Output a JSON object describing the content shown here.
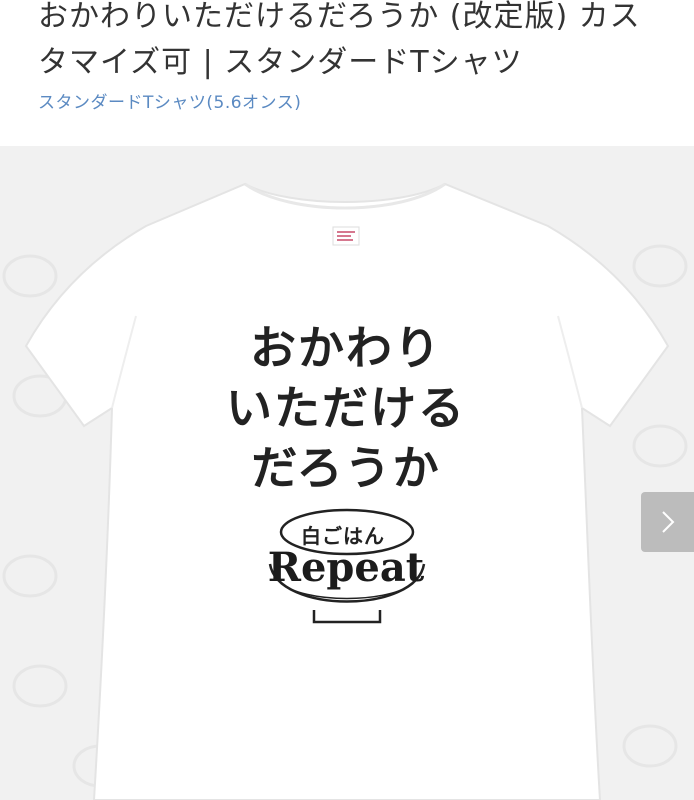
{
  "product": {
    "title": "おかわりいただけるだろうか (改定版) カスタマイズ可 | スタンダードTシャツ",
    "category_link": "スタンダードTシャツ(5.6オンス)"
  },
  "print": {
    "line1": "おかわり",
    "line2": "いただける",
    "line3": "だろうか",
    "bowl_label": "白ごはん",
    "repeat": "Repeat"
  },
  "colors": {
    "title": "#333333",
    "link": "#5b8ac2",
    "background": "#f1f1f1",
    "shirt": "#ffffff"
  },
  "icons": {
    "next": "chevron-right-icon"
  }
}
